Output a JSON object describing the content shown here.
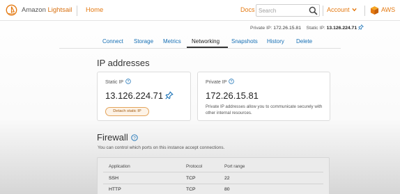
{
  "header": {
    "brand_prefix": "Amazon ",
    "brand_name": "Lightsail",
    "home_label": "Home",
    "docs_label": "Docs",
    "search_placeholder": "Search",
    "account_label": "Account",
    "aws_label": "AWS",
    "icons": [
      "lightsail-logo-icon",
      "search-icon",
      "chevron-down-icon",
      "aws-box-icon"
    ]
  },
  "ip_summary": {
    "private_label": "Private IP:",
    "private_value": "172.26.15.81",
    "static_label": "Static IP:",
    "static_value": "13.126.224.71"
  },
  "tabs": [
    {
      "label": "Connect"
    },
    {
      "label": "Storage"
    },
    {
      "label": "Metrics"
    },
    {
      "label": "Networking",
      "active": true
    },
    {
      "label": "Snapshots"
    },
    {
      "label": "History"
    },
    {
      "label": "Delete"
    }
  ],
  "ip_section": {
    "title": "IP addresses",
    "static_card": {
      "label": "Static IP",
      "value": "13.126.224.71",
      "detach_label": "Detach static IP"
    },
    "private_card": {
      "label": "Private IP",
      "value": "172.26.15.81",
      "description": "Private IP addresses allow you to communicate securely with other internal resources."
    }
  },
  "firewall": {
    "title": "Firewall",
    "description": "You can control which ports on this instance accept connections.",
    "columns": [
      "Application",
      "Protocol",
      "Port range"
    ],
    "rows": [
      [
        "SSH",
        "TCP",
        "22"
      ],
      [
        "HTTP",
        "TCP",
        "80"
      ]
    ]
  },
  "colors": {
    "accent": "#e47911",
    "link": "#146eb4",
    "pin": "#146eb4"
  }
}
